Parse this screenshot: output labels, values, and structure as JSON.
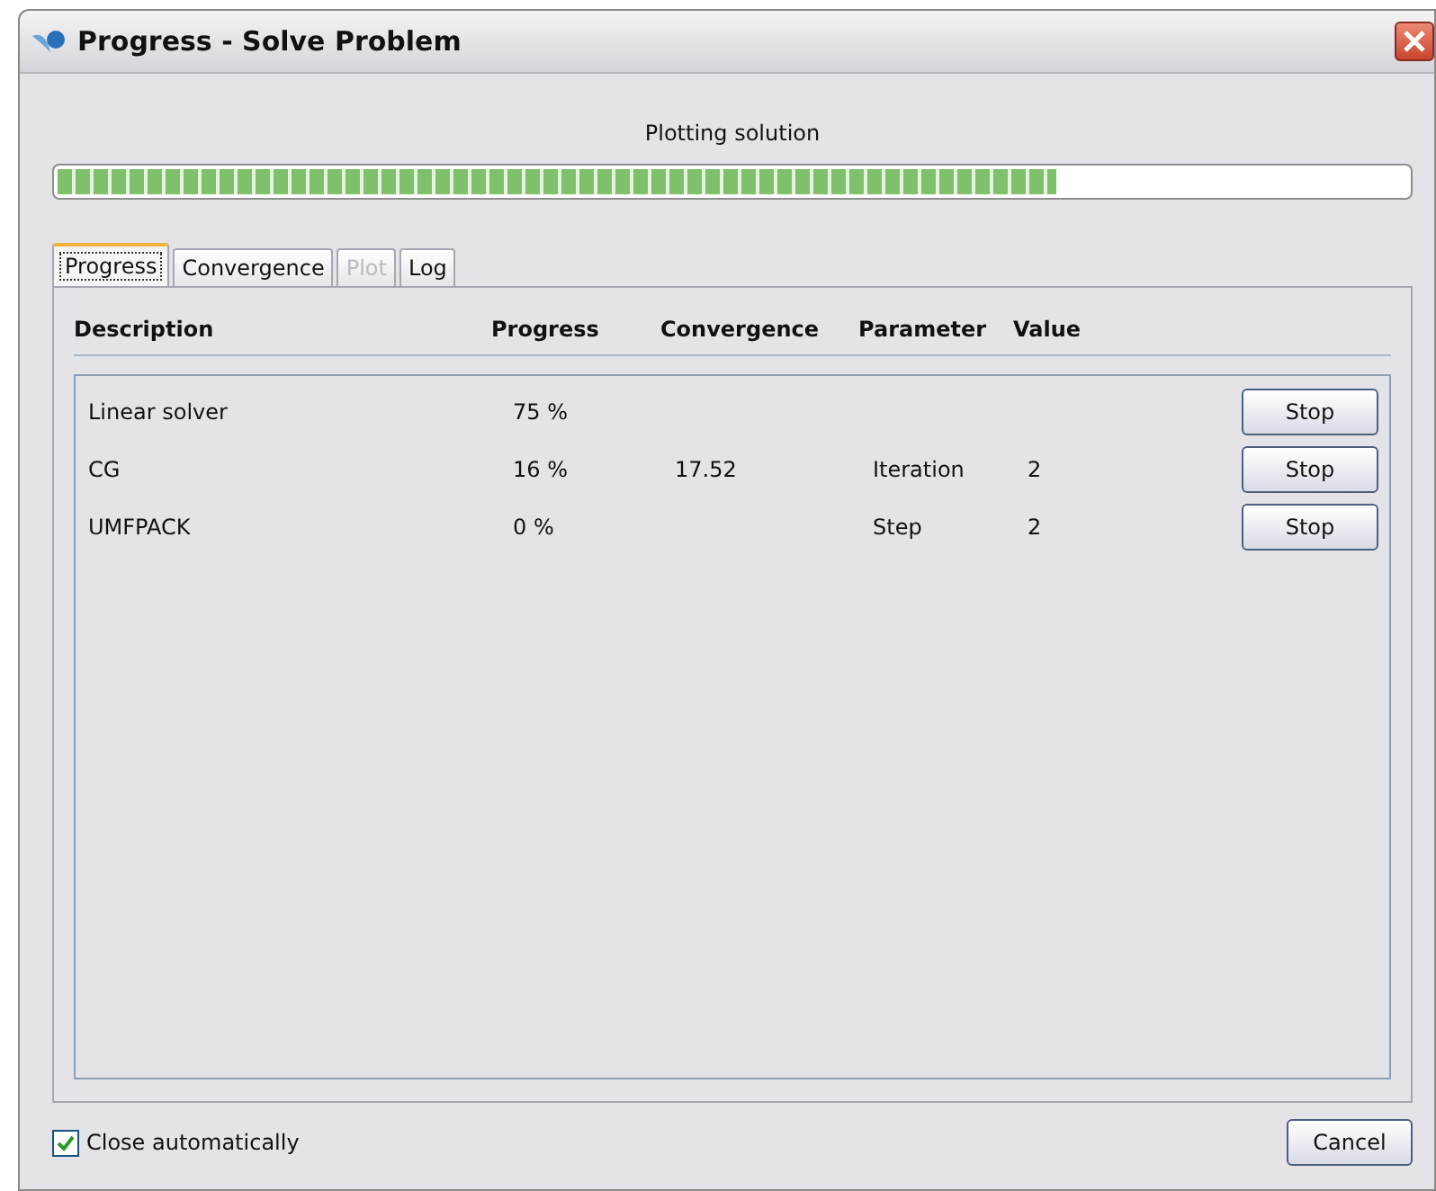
{
  "window": {
    "title": "Progress - Solve Problem"
  },
  "status": {
    "label": "Plotting solution",
    "level": 0.74
  },
  "tabs": [
    {
      "label": "Progress",
      "selected": true,
      "disabled": false
    },
    {
      "label": "Convergence",
      "selected": false,
      "disabled": false
    },
    {
      "label": "Plot",
      "selected": false,
      "disabled": true
    },
    {
      "label": "Log",
      "selected": false,
      "disabled": false
    }
  ],
  "table": {
    "columns": [
      "Description",
      "Progress",
      "Convergence",
      "Parameter",
      "Value"
    ],
    "rows": [
      {
        "cells": [
          "Linear solver",
          "75 %",
          "",
          "",
          ""
        ],
        "button": "Stop"
      },
      {
        "cells": [
          "CG",
          "16 %",
          "17.52",
          "Iteration",
          "2"
        ],
        "button": "Stop"
      },
      {
        "cells": [
          "UMFPACK",
          "0 %",
          "",
          "Step",
          "2"
        ],
        "button": "Stop"
      }
    ]
  },
  "close_automatically": {
    "label": "Close automatically",
    "checked": true
  },
  "cancel_button": "Cancel"
}
